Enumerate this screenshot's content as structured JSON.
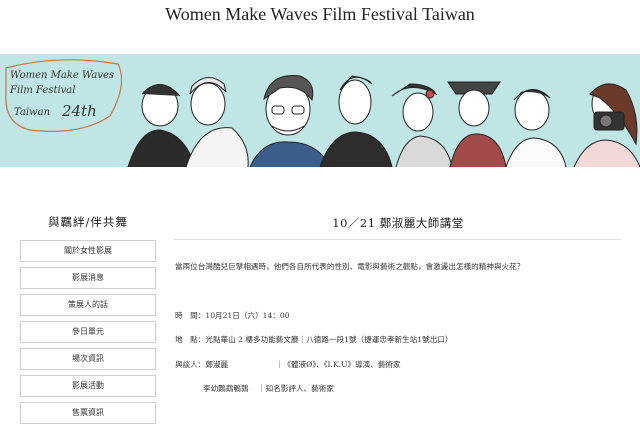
{
  "site": {
    "title": "Women Make Waves Film Festival Taiwan"
  },
  "banner": {
    "logo_lines": [
      "Women Make Waves",
      "Film Festival",
      "Taiwan",
      "24th"
    ],
    "background_color": "#bfe6e4",
    "logo_color": "#c8734a"
  },
  "sidebar": {
    "title": "與羈絆/伴共舞",
    "items": [
      {
        "label": "關於女性影展"
      },
      {
        "label": "影展消息"
      },
      {
        "label": "策展人的話"
      },
      {
        "label": "參日單元"
      },
      {
        "label": "場次資訊"
      },
      {
        "label": "影展活動"
      },
      {
        "label": "售票資訊"
      }
    ]
  },
  "article": {
    "title": "10／21 鄭淑麗大師講堂",
    "intro": "當兩位台灣酷兒巨擘相遇時，他們各自所代表的性別、電影與藝術之觀點，會激盪出怎樣的精神與火花？",
    "time_label": "時　間",
    "time_value": "：10月21日（六）14：00",
    "place_label": "地　點",
    "place_value": "：光點華山 2 樓多功能藝文廳｜八德路一段1號（捷運忠孝新生站1號出口）",
    "guests_label": "與談人",
    "guests": [
      {
        "name": "：鄭淑麗",
        "desc": "｜《體液Ø》、《I.K.U》導演、藝術家"
      },
      {
        "name": "李幼鸚鵡鵪鶉",
        "desc": "｜知名影評人、藝術家"
      }
    ]
  }
}
